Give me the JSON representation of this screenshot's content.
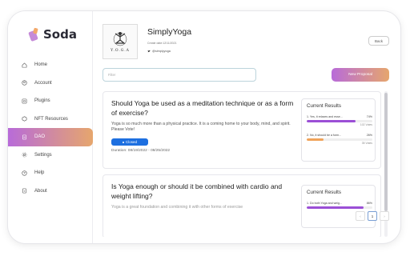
{
  "brand": {
    "name": "Soda"
  },
  "sidebar": {
    "items": [
      {
        "label": "Home",
        "icon": "home-icon"
      },
      {
        "label": "Account",
        "icon": "account-icon"
      },
      {
        "label": "Plugins",
        "icon": "plugins-icon"
      },
      {
        "label": "NFT Resources",
        "icon": "nft-icon"
      },
      {
        "label": "DAO",
        "icon": "dao-icon",
        "active": true
      },
      {
        "label": "Settings",
        "icon": "gear-icon"
      },
      {
        "label": "Help",
        "icon": "help-icon"
      },
      {
        "label": "About",
        "icon": "about-icon"
      }
    ]
  },
  "org": {
    "title": "SimplyYoga",
    "logo_text": "Y.O.G.A",
    "created": "Create date:12/11/2021",
    "twitter": "@simplyyoga"
  },
  "header": {
    "back_label": "Back",
    "filter_placeholder": "Filter",
    "new_proposal_label": "New Proposal"
  },
  "proposals": [
    {
      "title": "Should Yoga be used as a meditation technique or as a form of exercise?",
      "description": "Yoga is so much more than a physical practice. It is a coming home to your body, mind, and spirit. Please Vote!",
      "status": "Closed",
      "duration": "Duration: 08/19/2022 - 08/25/2022",
      "results_title": "Current Results",
      "options": [
        {
          "label": "1. Yes, it relaxes and esse...",
          "percent": 74,
          "percent_label": "74%",
          "votes": "102 Votes"
        },
        {
          "label": "2. No, it should be a form...",
          "percent": 26,
          "percent_label": "26%",
          "votes": "35 Votes"
        }
      ]
    },
    {
      "title": "Is Yoga enough or should it be combined with cardio and weight lifting?",
      "description": "Yoga is a great foundation and combining it with other forms of exercise",
      "results_title": "Current Results",
      "options": [
        {
          "label": "1. Do both Yoga and weig...",
          "percent": 86,
          "percent_label": "86%",
          "votes": ""
        }
      ]
    }
  ],
  "pagination": {
    "prev": "‹",
    "current": "1",
    "next": "›"
  },
  "colors": {
    "accent_start": "#b86bd9",
    "accent_end": "#e6a66d",
    "status_closed": "#1d6fe0",
    "bar_purple": "#9b4fd6",
    "bar_orange": "#f0a35a"
  }
}
